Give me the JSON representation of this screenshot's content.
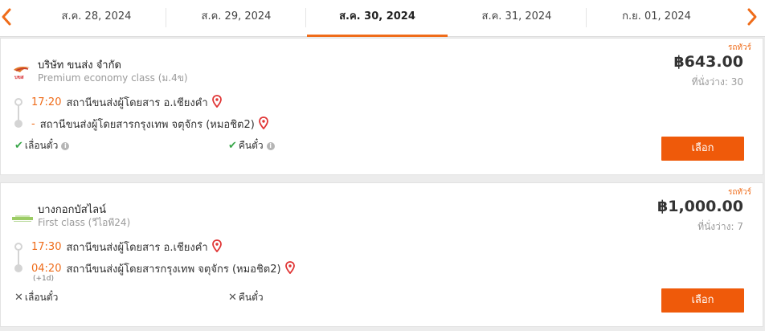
{
  "dates": {
    "tabs": [
      {
        "label": "ส.ค. 28, 2024",
        "active": false
      },
      {
        "label": "ส.ค. 29, 2024",
        "active": false
      },
      {
        "label": "ส.ค. 30, 2024",
        "active": true
      },
      {
        "label": "ส.ค. 31, 2024",
        "active": false
      },
      {
        "label": "ก.ย. 01, 2024",
        "active": false
      }
    ],
    "prev_icon": "chevron-left-icon",
    "next_icon": "chevron-right-icon"
  },
  "trips": [
    {
      "bus_type": "รถทัวร์",
      "operator": "บริษัท ขนส่ง จำกัด",
      "class": "Premium economy class (ม.4ข)",
      "price": "฿643.00",
      "seats": "ที่นั่งว่าง: 30",
      "depart_time": "17:20",
      "depart_station": "สถานีขนส่งผู้โดยสาร อ.เชียงคำ",
      "arrive_time": "-",
      "arrive_station": "สถานีขนส่งผู้โดยสารกรุงเทพ จตุจักร (หมอชิต2)",
      "arrive_day": "",
      "amenities": [
        {
          "label": "เลื่อนตั๋ว",
          "available": true
        },
        {
          "label": "คืนตั๋ว",
          "available": true
        }
      ],
      "select_label": "เลือก"
    },
    {
      "bus_type": "รถทัวร์",
      "operator": "บางกอกบัสไลน์",
      "class": "First class (วีไอพี24)",
      "price": "฿1,000.00",
      "seats": "ที่นั่งว่าง: 7",
      "depart_time": "17:30",
      "depart_station": "สถานีขนส่งผู้โดยสาร อ.เชียงคำ",
      "arrive_time": "04:20",
      "arrive_station": "สถานีขนส่งผู้โดยสารกรุงเทพ จตุจักร (หมอชิต2)",
      "arrive_day": "(+1d)",
      "amenities": [
        {
          "label": "เลื่อนตั๋ว",
          "available": false
        },
        {
          "label": "คืนตั๋ว",
          "available": false
        }
      ],
      "select_label": "เลือก"
    }
  ],
  "colors": {
    "accent": "#ef6c1a",
    "button": "#ef5a0a",
    "check": "#3aa74a",
    "pin": "#e03535"
  }
}
